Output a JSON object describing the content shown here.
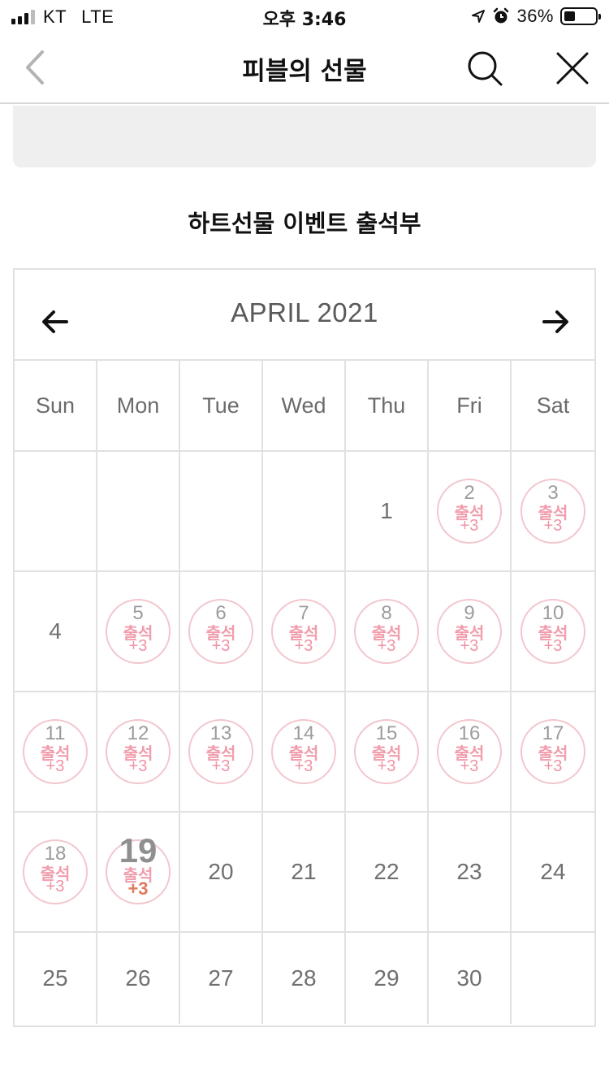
{
  "status_bar": {
    "carrier": "KT",
    "network": "LTE",
    "time": "오후 3:46",
    "battery": "36%",
    "battery_level": 0.36
  },
  "nav": {
    "title": "피블의 선물",
    "back_icon": "chevron-left-icon",
    "search_icon": "search-icon",
    "close_icon": "close-icon"
  },
  "event_title": "하트선물 이벤트 출석부",
  "calendar": {
    "month_label": "APRIL 2021",
    "weekdays": [
      "Sun",
      "Mon",
      "Tue",
      "Wed",
      "Thu",
      "Fri",
      "Sat"
    ],
    "stamp_label": "출석",
    "stamp_points": "+3",
    "today": 19,
    "weeks": [
      [
        null,
        null,
        null,
        null,
        {
          "day": "1"
        },
        {
          "day": "2",
          "att": true
        },
        {
          "day": "3",
          "att": true
        }
      ],
      [
        {
          "day": "4"
        },
        {
          "day": "5",
          "att": true
        },
        {
          "day": "6",
          "att": true
        },
        {
          "day": "7",
          "att": true
        },
        {
          "day": "8",
          "att": true
        },
        {
          "day": "9",
          "att": true
        },
        {
          "day": "10",
          "att": true
        }
      ],
      [
        {
          "day": "11",
          "att": true
        },
        {
          "day": "12",
          "att": true
        },
        {
          "day": "13",
          "att": true
        },
        {
          "day": "14",
          "att": true
        },
        {
          "day": "15",
          "att": true
        },
        {
          "day": "16",
          "att": true
        },
        {
          "day": "17",
          "att": true
        }
      ],
      [
        {
          "day": "18",
          "att": true
        },
        {
          "day": "19",
          "att": true,
          "today": true
        },
        {
          "day": "20"
        },
        {
          "day": "21"
        },
        {
          "day": "22"
        },
        {
          "day": "23"
        },
        {
          "day": "24"
        }
      ],
      [
        {
          "day": "25"
        },
        {
          "day": "26"
        },
        {
          "day": "27"
        },
        {
          "day": "28"
        },
        {
          "day": "29"
        },
        {
          "day": "30"
        },
        null
      ]
    ]
  },
  "colors": {
    "stamp_border": "#f2c6cd",
    "stamp_text": "#ef93a4",
    "today_points": "#e07a5f",
    "grid_line": "#e1e1e1"
  }
}
